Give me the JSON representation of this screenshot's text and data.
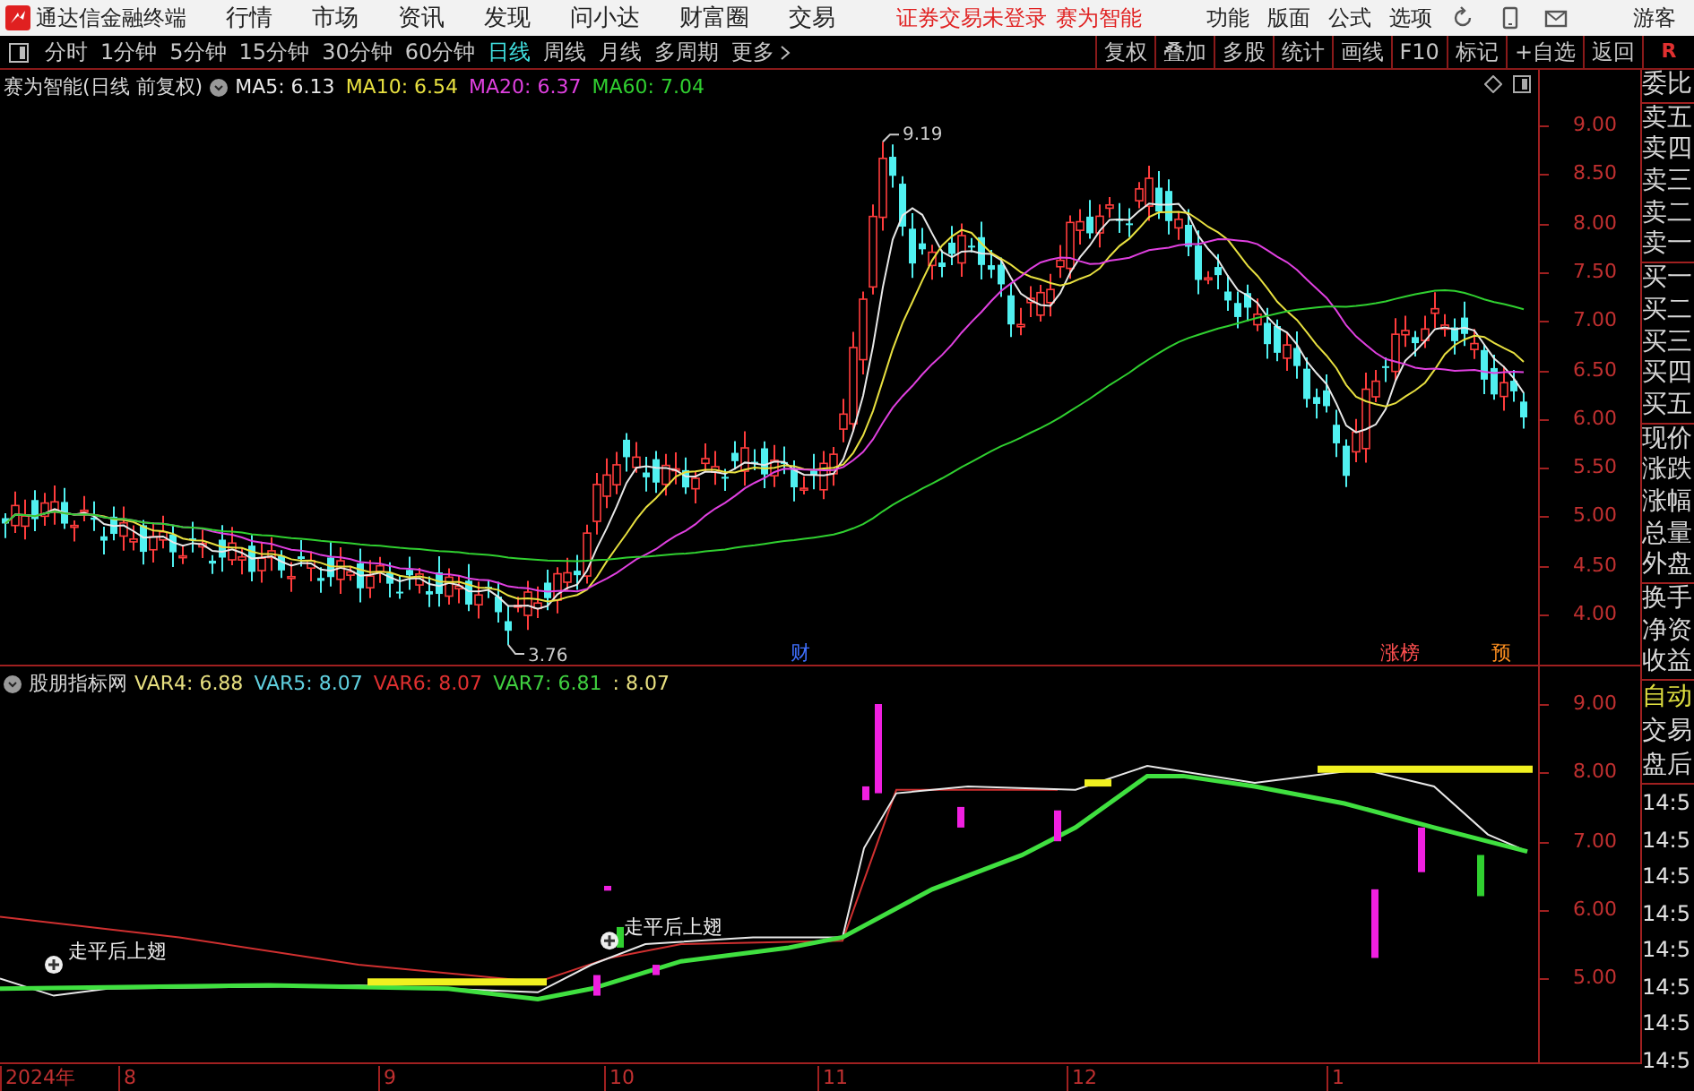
{
  "menubar": {
    "app_title": "通达信金融终端",
    "menus": [
      "行情",
      "市场",
      "资讯",
      "发现",
      "问小达",
      "财富圈",
      "交易"
    ],
    "notice": "证券交易未登录",
    "stock": "赛为智能",
    "tools": [
      "功能",
      "版面",
      "公式",
      "选项"
    ],
    "user": "游客"
  },
  "toolbar": {
    "periods": [
      {
        "label": "分时",
        "selected": false
      },
      {
        "label": "1分钟",
        "selected": false
      },
      {
        "label": "5分钟",
        "selected": false
      },
      {
        "label": "15分钟",
        "selected": false
      },
      {
        "label": "30分钟",
        "selected": false
      },
      {
        "label": "60分钟",
        "selected": false
      },
      {
        "label": "日线",
        "selected": true
      },
      {
        "label": "周线",
        "selected": false
      },
      {
        "label": "月线",
        "selected": false
      },
      {
        "label": "多周期",
        "selected": false
      },
      {
        "label": "更多",
        "selected": false
      }
    ],
    "actions": [
      "复权",
      "叠加",
      "多股",
      "统计",
      "画线",
      "F10",
      "标记",
      "+自选",
      "返回"
    ],
    "side_header": "R"
  },
  "main_chart": {
    "legend_title": "赛为智能(日线 前复权)",
    "indicators": [
      {
        "label": "MA5: 6.13",
        "color": "#e8e8e8"
      },
      {
        "label": "MA10: 6.54",
        "color": "#e8e040"
      },
      {
        "label": "MA20: 6.37",
        "color": "#e040e0"
      },
      {
        "label": "MA60: 7.04",
        "color": "#30d030"
      }
    ],
    "y_ticks": [
      "9.00",
      "8.50",
      "8.00",
      "7.50",
      "7.00",
      "6.50",
      "6.00",
      "5.50",
      "5.00",
      "4.50",
      "4.00"
    ],
    "annotations": [
      {
        "kind": "high",
        "text": "9.19"
      },
      {
        "kind": "low",
        "text": "3.76"
      },
      {
        "kind": "marker",
        "text": "财",
        "color": "#4070ff"
      },
      {
        "kind": "marker",
        "text": "涨榜",
        "color": "#ff5050"
      },
      {
        "kind": "marker",
        "text": "预",
        "color": "#ff9020"
      }
    ]
  },
  "indicator_chart": {
    "title": "股朋指标网",
    "values": [
      {
        "label": "VAR4: 6.88",
        "color": "#e8e080"
      },
      {
        "label": "VAR5: 8.07",
        "color": "#60d0e0"
      },
      {
        "label": "VAR6: 8.07",
        "color": "#e03030"
      },
      {
        "label": "VAR7: 6.81",
        "color": "#40d040"
      },
      {
        "label": ": 8.07",
        "color": "#e8e080"
      }
    ],
    "y_ticks": [
      "9.00",
      "8.00",
      "7.00",
      "6.00",
      "5.00"
    ],
    "signals": [
      "走平后上翅",
      "走平后上翅"
    ]
  },
  "x_axis": [
    "2024年",
    "8",
    "9",
    "10",
    "11",
    "12",
    "1"
  ],
  "quote_panel": {
    "groups": [
      [
        "委比"
      ],
      [
        "卖五",
        "卖四",
        "卖三",
        "卖二",
        "卖一"
      ],
      [
        "买一",
        "买二",
        "买三",
        "买四",
        "买五"
      ],
      [
        "现价",
        "涨跌",
        "涨幅",
        "总量",
        "外盘"
      ],
      [
        "换手",
        "净资",
        "收益"
      ]
    ]
  },
  "trade_panel": {
    "mode": "自动",
    "items": [
      "交易",
      "盘后"
    ],
    "times": [
      "14:5",
      "14:5",
      "14:5",
      "14:5",
      "14:5",
      "14:5",
      "14:5",
      "14:5"
    ]
  }
}
